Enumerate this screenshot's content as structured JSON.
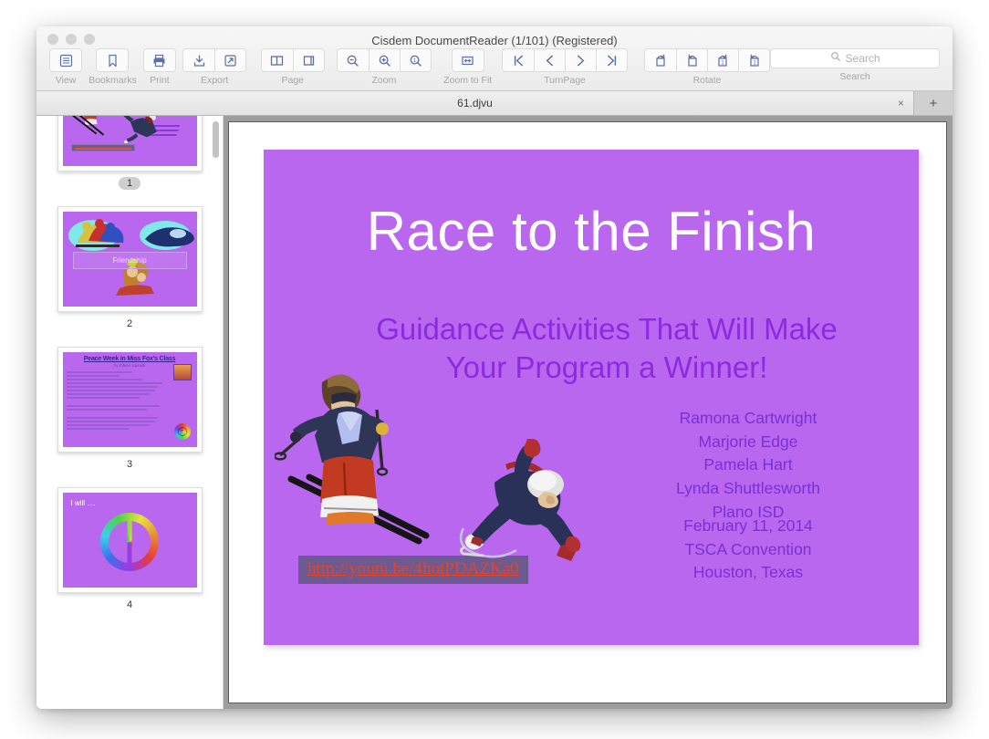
{
  "window": {
    "title": "Cisdem DocumentReader (1/101) (Registered)",
    "traffic_lights": [
      "close",
      "minimize",
      "zoom"
    ]
  },
  "toolbar": {
    "groups": [
      {
        "label": "View",
        "buttons": [
          {
            "icon": "list-view-icon"
          }
        ]
      },
      {
        "label": "Bookmarks",
        "buttons": [
          {
            "icon": "bookmark-icon"
          }
        ]
      },
      {
        "label": "Print",
        "buttons": [
          {
            "icon": "printer-icon"
          }
        ]
      },
      {
        "label": "Export",
        "buttons": [
          {
            "icon": "download-icon"
          },
          {
            "icon": "share-arrow-icon"
          }
        ]
      },
      {
        "label": "Page",
        "buttons": [
          {
            "icon": "two-page-icon"
          },
          {
            "icon": "single-page-icon"
          }
        ]
      },
      {
        "label": "Zoom",
        "buttons": [
          {
            "icon": "zoom-out-icon"
          },
          {
            "icon": "zoom-in-icon"
          },
          {
            "icon": "actual-size-icon"
          }
        ]
      },
      {
        "label": "Zoom to Fit",
        "buttons": [
          {
            "icon": "fit-width-icon"
          }
        ]
      },
      {
        "label": "TurnPage",
        "buttons": [
          {
            "icon": "first-page-icon"
          },
          {
            "icon": "previous-page-icon"
          },
          {
            "icon": "next-page-icon"
          },
          {
            "icon": "last-page-icon"
          }
        ]
      },
      {
        "label": "Rotate",
        "buttons": [
          {
            "icon": "rotate-right-icon"
          },
          {
            "icon": "rotate-left-icon"
          },
          {
            "icon": "rotate-page-right-icon"
          },
          {
            "icon": "rotate-page-left-icon"
          }
        ]
      }
    ],
    "search": {
      "label": "Search",
      "placeholder": "Search",
      "value": "",
      "icon": "search-icon"
    }
  },
  "tabbar": {
    "active_tab": "61.djvu",
    "close_label": "×",
    "add_label": "+"
  },
  "sidebar": {
    "thumbnails": [
      {
        "number": "1",
        "active": true,
        "caption": "Race to the Finish title slide"
      },
      {
        "number": "2",
        "active": false,
        "caption": "Friendship",
        "band_text": "Friendship"
      },
      {
        "number": "3",
        "active": false,
        "title": "Peace Week in Miss Fox's Class",
        "subtitle": "by Eileen Spinelli"
      },
      {
        "number": "4",
        "active": false,
        "label": "I will ...."
      }
    ],
    "scrollbar": "vertical-scrollbar"
  },
  "slide": {
    "background_color": "#b967ee",
    "title": "Race to the Finish",
    "title_color": "#ffffff",
    "subtitle_line1": "Guidance Activities That Will Make",
    "subtitle_line2": "Your Program a Winner!",
    "subtitle_color": "#8a2be2",
    "presenters": [
      "Ramona Cartwright",
      "Marjorie Edge",
      "Pamela Hart",
      "Lynda Shuttlesworth",
      "Plano ISD"
    ],
    "event": [
      "February 11, 2014",
      "TSCA Convention",
      "Houston, Texas"
    ],
    "text_color": "#7b2fd4",
    "video_link_text": "http://youtu.be/4hotPDAZKa0",
    "video_link_color": "#e0452c",
    "video_link_bg": "#6d5a91",
    "clipart": [
      "skier-image",
      "speed-skater-image"
    ]
  }
}
